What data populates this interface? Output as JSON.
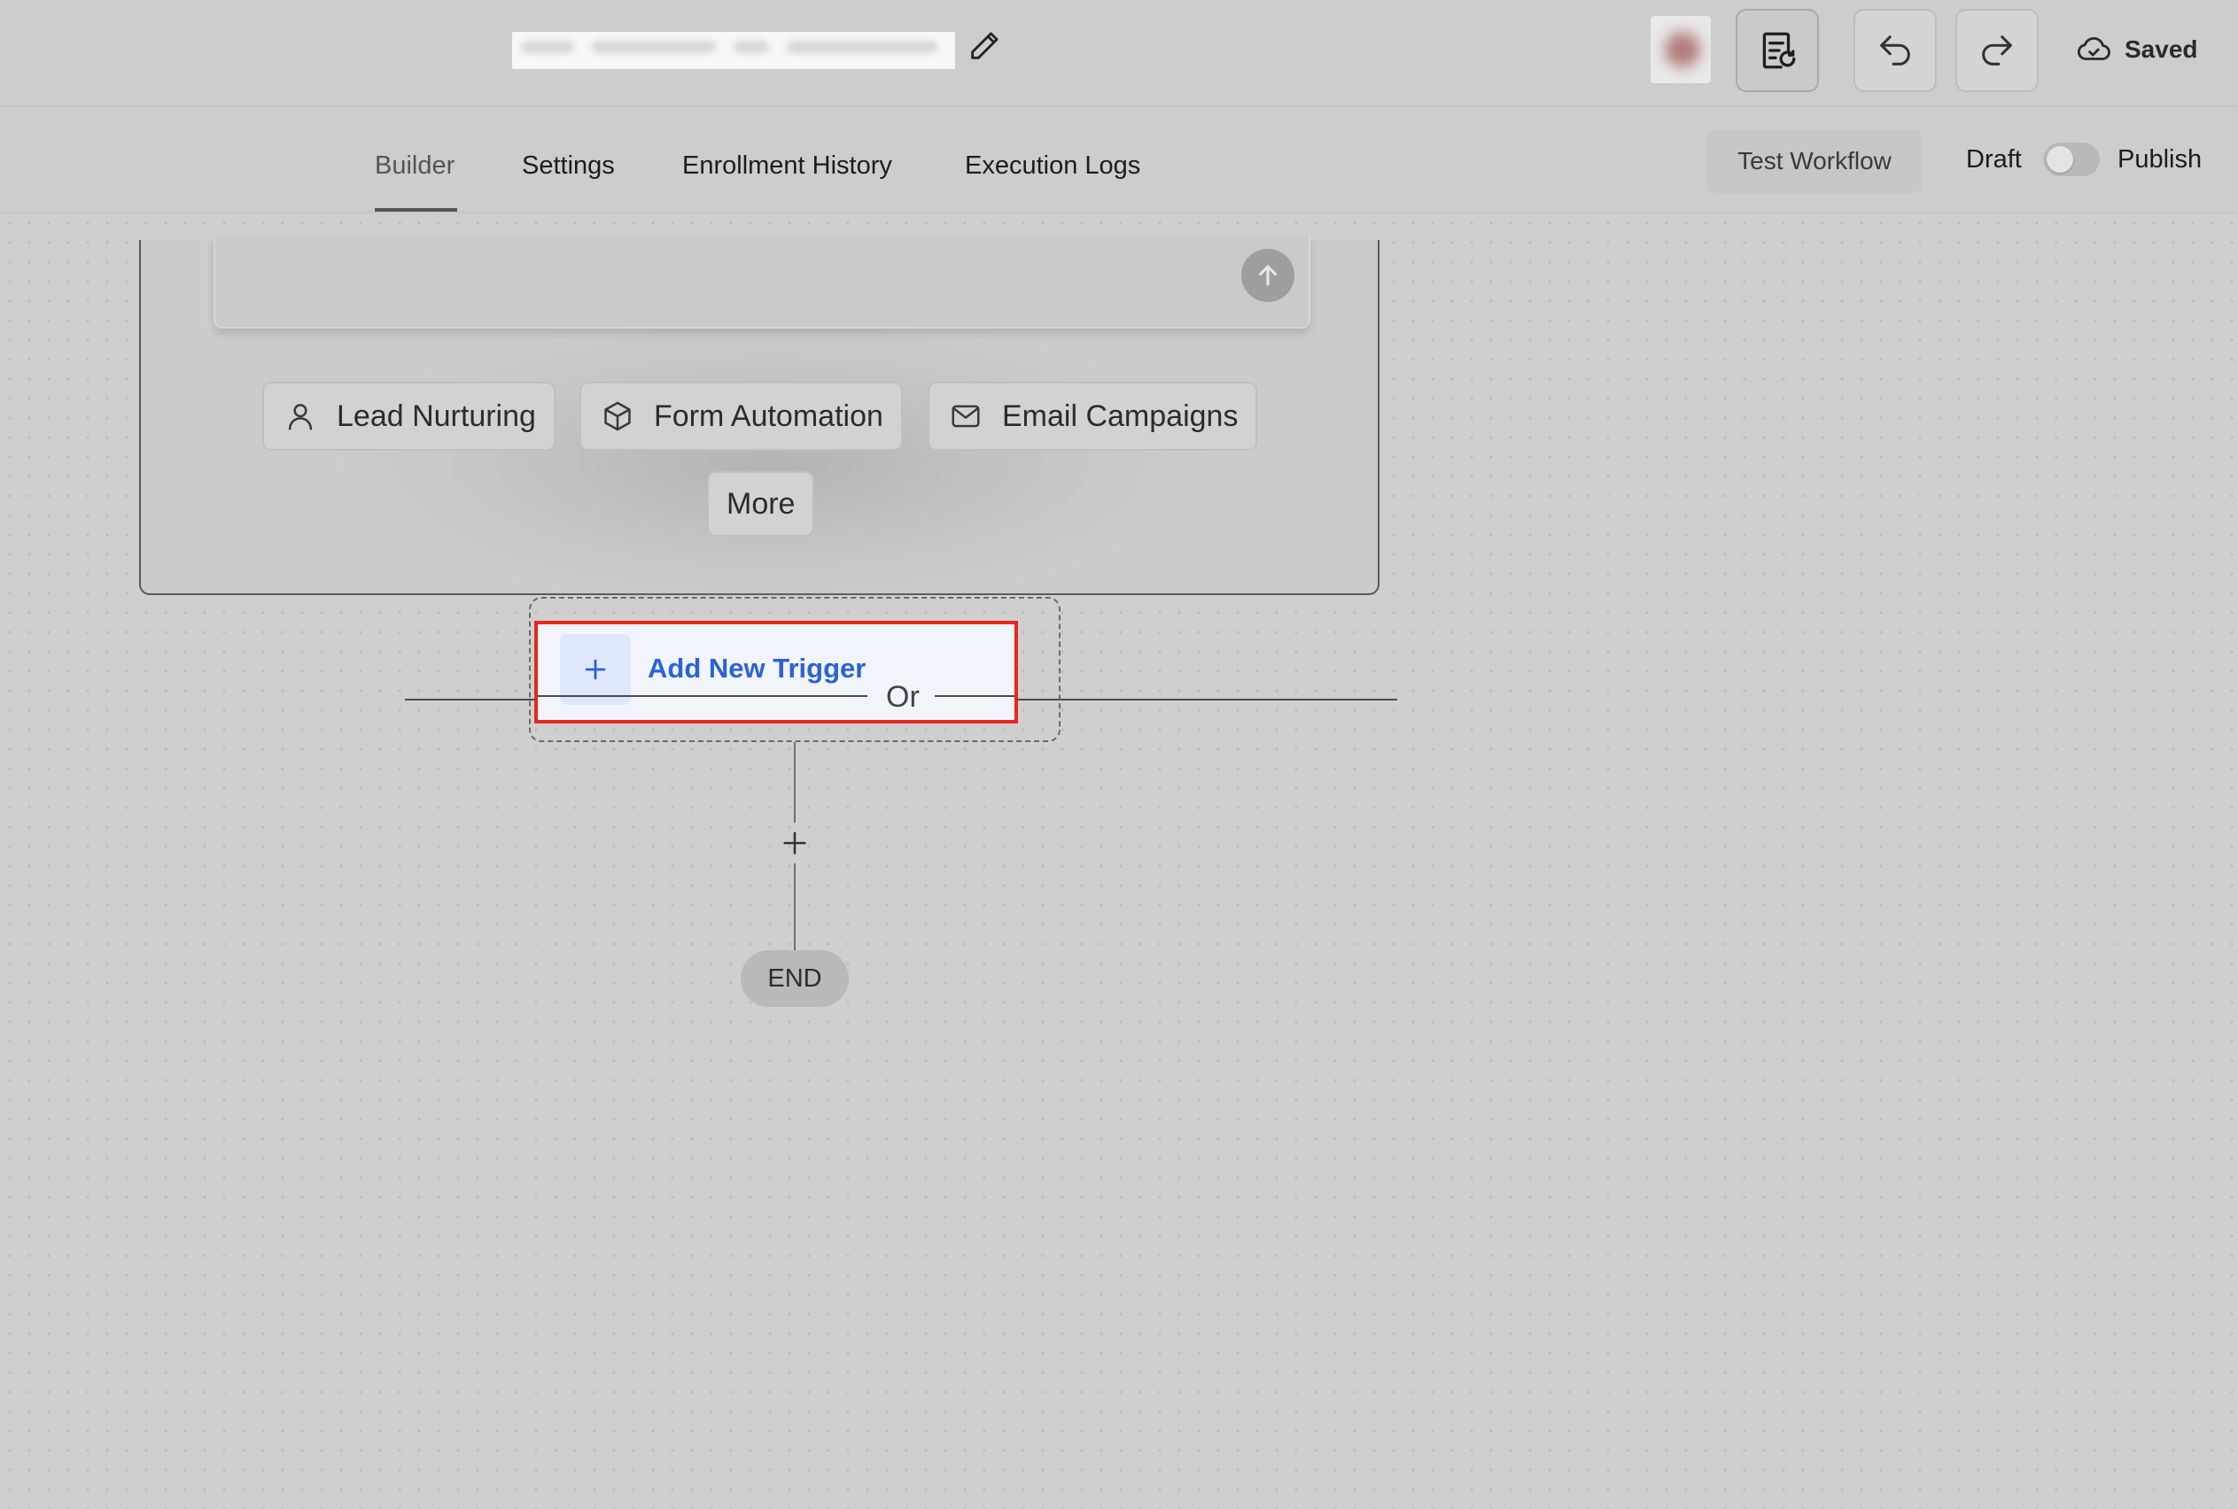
{
  "header": {
    "edit_icon": "pencil-icon",
    "avatar_icon": "user-avatar",
    "notes_button_icon": "document-refresh-icon",
    "undo_icon": "undo-icon",
    "redo_icon": "redo-icon",
    "saved_icon": "cloud-check-icon",
    "saved_label": "Saved"
  },
  "tabs": {
    "items": [
      "Builder",
      "Settings",
      "Enrollment History",
      "Execution Logs"
    ],
    "active": "Builder"
  },
  "actions": {
    "test_workflow_label": "Test Workflow",
    "draft_label": "Draft",
    "publish_label": "Publish",
    "publish_toggle_on": false
  },
  "ai_builder": {
    "send_icon": "arrow-up-icon",
    "suggestions": [
      {
        "label": "Lead Nurturing",
        "icon": "user-icon"
      },
      {
        "label": "Form Automation",
        "icon": "cube-icon"
      },
      {
        "label": "Email Campaigns",
        "icon": "mail-icon"
      }
    ],
    "more_label": "More"
  },
  "workflow": {
    "add_trigger_label": "Add New Trigger",
    "add_trigger_icon": "plus-icon",
    "or_label": "Or",
    "add_step_icon": "plus-icon",
    "end_label": "END"
  },
  "colors": {
    "highlight_border": "#e8261f",
    "trigger_text": "#2a62d9",
    "trigger_bg": "#f1f4fb"
  }
}
